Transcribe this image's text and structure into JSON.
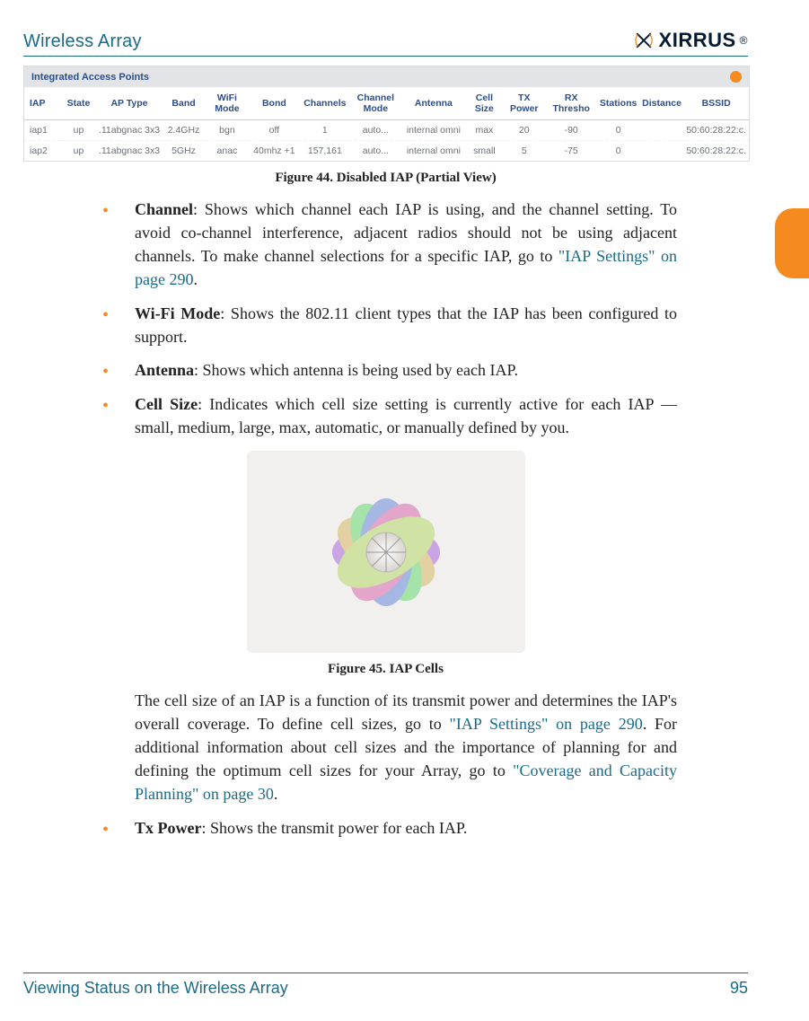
{
  "header": {
    "title": "Wireless Array",
    "logo_text": "XIRRUS"
  },
  "table": {
    "bar_title": "Integrated Access Points",
    "columns": [
      "IAP",
      "State",
      "AP Type",
      "Band",
      "WiFi Mode",
      "Bond",
      "Channels",
      "Channel Mode",
      "Antenna",
      "Cell Size",
      "TX Power",
      "RX Thresho",
      "Stations",
      "Distance",
      "BSSID"
    ],
    "rows": [
      [
        "iap1",
        "up",
        ".11abgnac 3x3",
        "2.4GHz",
        "bgn",
        "off",
        "1",
        "auto...",
        "internal omni",
        "max",
        "20",
        "-90",
        "0",
        "",
        "50:60:28:22:c."
      ],
      [
        "iap2",
        "up",
        ".11abgnac 3x3",
        "5GHz",
        "anac",
        "40mhz +1",
        "157,161",
        "auto...",
        "internal omni",
        "small",
        "5",
        "-75",
        "0",
        "",
        "50:60:28:22:c."
      ]
    ]
  },
  "fig44_caption": "Figure 44. Disabled IAP (Partial View)",
  "bullets": {
    "channel_term": "Channel",
    "channel_text": ": Shows which channel each IAP is using, and the channel setting. To avoid co-channel interference, adjacent radios should not be using adjacent channels. To make channel selections for a specific IAP, go to ",
    "channel_link": "\"IAP Settings\" on page 290",
    "channel_tail": ".",
    "wifi_term": "Wi-Fi Mode",
    "wifi_text": ": Shows the 802.11 client types that the IAP has been configured to support.",
    "antenna_term": "Antenna",
    "antenna_text": ": Shows which antenna is being used by each IAP.",
    "cell_term": "Cell Size",
    "cell_text": ": Indicates which cell size setting is currently active for each IAP — small, medium, large, max, automatic, or manually defined by you."
  },
  "fig45_caption": "Figure 45. IAP Cells",
  "para": {
    "p1a": "The cell size of an IAP is a function of its transmit power and determines the IAP's overall coverage. To define cell sizes, go to ",
    "p1_link1": "\"IAP Settings\" on page 290",
    "p1b": ". For additional information about cell sizes and the importance of planning for and defining the optimum cell sizes for your Array, go to ",
    "p1_link2": "\"Coverage and Capacity Planning\" on page 30",
    "p1c": "."
  },
  "tx": {
    "term": "Tx Power",
    "text": ": Shows the transmit power for each IAP."
  },
  "footer": {
    "left": "Viewing Status on the Wireless Array",
    "right": "95"
  },
  "chart_data": {
    "type": "table",
    "title": "Integrated Access Points",
    "columns": [
      "IAP",
      "State",
      "AP Type",
      "Band",
      "WiFi Mode",
      "Bond",
      "Channels",
      "Channel Mode",
      "Antenna",
      "Cell Size",
      "TX Power",
      "RX Threshold",
      "Stations",
      "Distance",
      "BSSID"
    ],
    "rows": [
      {
        "IAP": "iap1",
        "State": "up",
        "AP Type": ".11abgnac 3x3",
        "Band": "2.4GHz",
        "WiFi Mode": "bgn",
        "Bond": "off",
        "Channels": 1,
        "Channel Mode": "auto",
        "Antenna": "internal omni",
        "Cell Size": "max",
        "TX Power": 20,
        "RX Threshold": -90,
        "Stations": 0,
        "Distance": null,
        "BSSID": "50:60:28:22:c."
      },
      {
        "IAP": "iap2",
        "State": "up",
        "AP Type": ".11abgnac 3x3",
        "Band": "5GHz",
        "WiFi Mode": "anac",
        "Bond": "40mhz +1",
        "Channels": "157,161",
        "Channel Mode": "auto",
        "Antenna": "internal omni",
        "Cell Size": "small",
        "TX Power": 5,
        "RX Threshold": -75,
        "Stations": 0,
        "Distance": null,
        "BSSID": "50:60:28:22:c."
      }
    ]
  }
}
